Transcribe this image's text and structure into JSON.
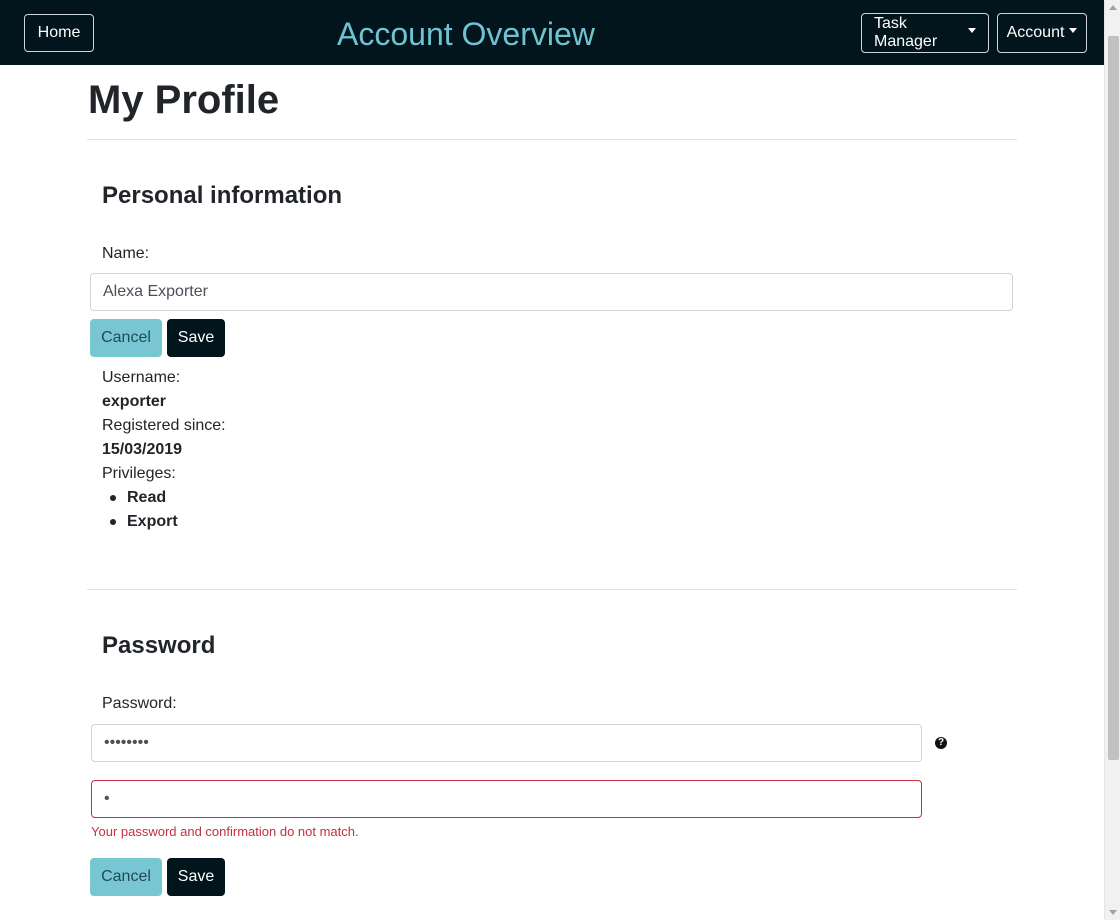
{
  "navbar": {
    "home_label": "Home",
    "title": "Account Overview",
    "task_manager_label": "Task Manager",
    "account_label": "Account"
  },
  "page": {
    "title": "My Profile"
  },
  "personal": {
    "section_title": "Personal information",
    "name_label": "Name:",
    "name_value": "Alexa Exporter",
    "cancel_label": "Cancel",
    "save_label": "Save",
    "username_label": "Username:",
    "username_value": "exporter",
    "registered_label": "Registered since:",
    "registered_value": "15/03/2019",
    "privileges_label": "Privileges:",
    "privileges": [
      "Read",
      "Export"
    ]
  },
  "password": {
    "section_title": "Password",
    "password_label": "Password:",
    "password_value": "••••••••",
    "confirm_value": "•",
    "help_icon": "question-circle-icon",
    "error_message": "Your password and confirmation do not match.",
    "cancel_label": "Cancel",
    "save_label": "Save"
  },
  "colors": {
    "navbar_bg": "#02141c",
    "title_accent": "#6fc3d2",
    "cancel_button": "#78c6d4",
    "save_button": "#02141c",
    "error": "#c3303f"
  }
}
